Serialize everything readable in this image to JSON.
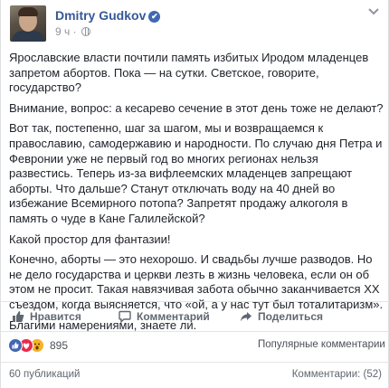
{
  "post": {
    "author": "Dmitry Gudkov",
    "time": "9 ч",
    "paragraphs": [
      "Ярославские власти почтили память избитых Иродом младенцев запретом абортов. Пока — на сутки. Светское, говорите, государство?",
      "Внимание, вопрос: а кесарево сечение в этот день тоже не делают?",
      "Вот так, постепенно, шаг за шагом, мы и возвращаемся к православию, самодержавию и народности. По случаю дня Петра и Февронии уже не первый год во многих регионах нельзя развестись. Теперь из-за вифлеемских младенцев запрещают аборты. Что дальше? Станут отключать воду на 40 дней во избежание Всемирного потопа? Запретят продажу алкоголя в память о чуде в Кане Галилейской?",
      "Какой простор для фантазии!",
      "Конечно, аборты — это нехорошо. И свадьбы лучше разводов. Но не дело государства и церкви лезть в жизнь человека, если он об этом не просит. Такая навязчивая забота обычно заканчивается XX съездом, когда выясняется, что «ой, а у нас тут был тоталитаризм».",
      "Благими намерениями, знаете ли."
    ]
  },
  "actions": {
    "like": "Нравится",
    "comment": "Комментарий",
    "share": "Поделиться"
  },
  "reactions": {
    "count": "895",
    "sort_label": "Популярные комментарии"
  },
  "footer": {
    "shares": "60 публикаций",
    "comments": "Комментарии: (52)"
  },
  "colors": {
    "link": "#365899",
    "like": "#4267b2",
    "love": "#f0284a",
    "wow": "#f7b125"
  }
}
